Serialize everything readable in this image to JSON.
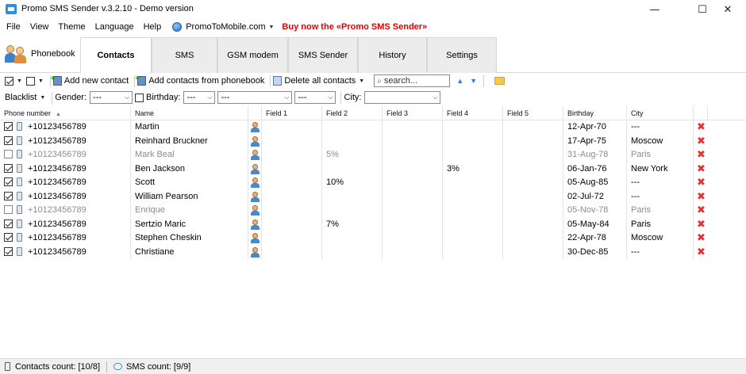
{
  "window": {
    "title": "Promo SMS Sender v.3.2.10 - Demo version",
    "minimize": "—",
    "maximize": "☐",
    "close": "✕"
  },
  "menu": {
    "items": [
      "File",
      "View",
      "Theme",
      "Language",
      "Help"
    ],
    "promo_link": "PromoToMobile.com",
    "buy_link": "Buy now the «Promo SMS Sender»"
  },
  "tabs": {
    "phonebook": "Phonebook",
    "items": [
      "Contacts",
      "SMS",
      "GSM modem",
      "SMS Sender",
      "History",
      "Settings"
    ],
    "active": "Contacts"
  },
  "toolbar": {
    "add_contact": "Add new contact",
    "add_from_phonebook": "Add contacts from phonebook",
    "delete_all": "Delete all contacts",
    "search_placeholder": "search..."
  },
  "filters": {
    "blacklist": "Blacklist",
    "gender_label": "Gender:",
    "gender_value": "---",
    "birthday_label": "Birthday:",
    "birthday_day": "---",
    "birthday_month": "---",
    "birthday_year": "---",
    "city_label": "City:",
    "city_value": ""
  },
  "grid": {
    "columns": [
      "Phone number",
      "Name",
      "",
      "Field 1",
      "Field 2",
      "Field 3",
      "Field 4",
      "Field 5",
      "Birthday",
      "City"
    ],
    "rows": [
      {
        "checked": true,
        "phone": "+10123456789",
        "name": "Martin",
        "f1": "",
        "f2": "",
        "f3": "",
        "f4": "",
        "f5": "",
        "birthday": "12-Apr-70",
        "city": "---"
      },
      {
        "checked": true,
        "phone": "+10123456789",
        "name": "Reinhard Bruckner",
        "f1": "",
        "f2": "",
        "f3": "",
        "f4": "",
        "f5": "",
        "birthday": "17-Apr-75",
        "city": "Moscow"
      },
      {
        "checked": false,
        "phone": "+10123456789",
        "name": "Mark Beal",
        "f1": "",
        "f2": "5%",
        "f3": "",
        "f4": "",
        "f5": "",
        "birthday": "31-Aug-78",
        "city": "Paris"
      },
      {
        "checked": true,
        "phone": "+10123456789",
        "name": "Ben Jackson",
        "f1": "",
        "f2": "",
        "f3": "",
        "f4": "3%",
        "f5": "",
        "birthday": "06-Jan-76",
        "city": "New York"
      },
      {
        "checked": true,
        "phone": "+10123456789",
        "name": "Scott",
        "f1": "",
        "f2": "10%",
        "f3": "",
        "f4": "",
        "f5": "",
        "birthday": "05-Aug-85",
        "city": "---"
      },
      {
        "checked": true,
        "phone": "+10123456789",
        "name": "William Pearson",
        "f1": "",
        "f2": "",
        "f3": "",
        "f4": "",
        "f5": "",
        "birthday": "02-Jul-72",
        "city": "---"
      },
      {
        "checked": false,
        "phone": "+10123456789",
        "name": "Enrique",
        "f1": "",
        "f2": "",
        "f3": "",
        "f4": "",
        "f5": "",
        "birthday": "05-Nov-78",
        "city": "Paris"
      },
      {
        "checked": true,
        "phone": "+10123456789",
        "name": "Sertzio Maric",
        "f1": "",
        "f2": "7%",
        "f3": "",
        "f4": "",
        "f5": "",
        "birthday": "05-May-84",
        "city": "Paris"
      },
      {
        "checked": true,
        "phone": "+10123456789",
        "name": "Stephen Cheskin",
        "f1": "",
        "f2": "",
        "f3": "",
        "f4": "",
        "f5": "",
        "birthday": "22-Apr-78",
        "city": "Moscow"
      },
      {
        "checked": true,
        "phone": "+10123456789",
        "name": "Christiane",
        "f1": "",
        "f2": "",
        "f3": "",
        "f4": "",
        "f5": "",
        "birthday": "30-Dec-85",
        "city": "---"
      }
    ]
  },
  "status": {
    "contacts": "Contacts count: [10/8]",
    "sms": "SMS count: [9/9]"
  },
  "colors": {
    "buy_link": "#e00000",
    "delete_x": "#e53030",
    "dim_text": "#8c8c8c"
  }
}
